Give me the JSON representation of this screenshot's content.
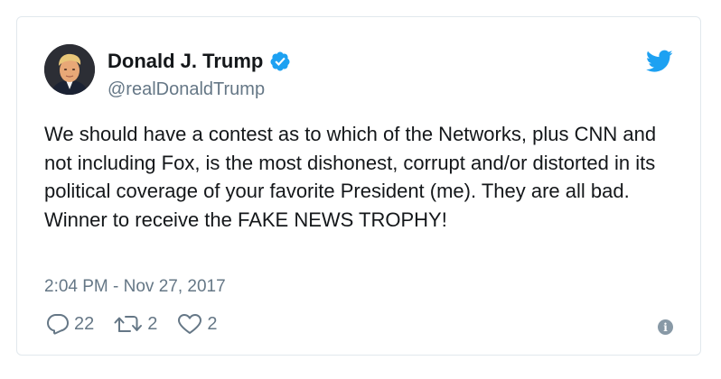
{
  "author": {
    "name": "Donald J. Trump",
    "handle": "@realDonaldTrump",
    "avatar_icon": "profile-photo",
    "verified_icon": "verified-badge-icon"
  },
  "tweet": {
    "text": "We should have a contest as to which of the Networks, plus CNN and not including Fox, is the most dishonest, corrupt and/or distorted in its political coverage of your favorite President (me). They are all bad. Winner to receive the FAKE NEWS TROPHY!",
    "timestamp": "2:04 PM - Nov 27, 2017"
  },
  "actions": {
    "reply_count": "22",
    "retweet_count": "2",
    "like_count": "2",
    "reply_icon": "reply-icon",
    "retweet_icon": "retweet-icon",
    "like_icon": "heart-icon",
    "info_icon": "info-icon"
  },
  "brand": {
    "logo_icon": "twitter-bird-icon",
    "accent": "#1da1f2",
    "muted": "#657786",
    "text": "#14171a",
    "border": "#e1e8ed"
  }
}
